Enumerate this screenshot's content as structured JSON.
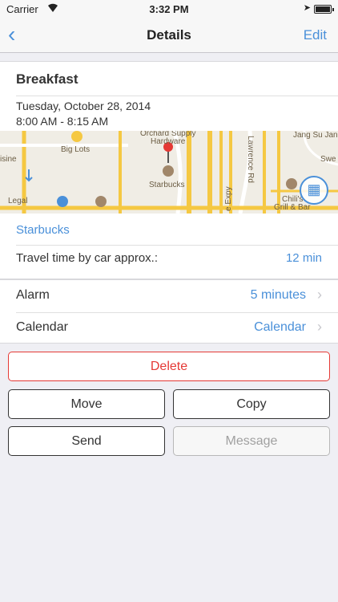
{
  "status": {
    "carrier": "Carrier",
    "time": "3:32 PM"
  },
  "nav": {
    "back": "‹",
    "title": "Details",
    "edit": "Edit"
  },
  "event": {
    "title": "Breakfast",
    "date": "Tuesday, October 28, 2014",
    "time": "8:00 AM - 8:15 AM",
    "place": "Starbucks",
    "travel_label": "Travel time by car approx.:",
    "travel_value": "12 min"
  },
  "map": {
    "labels": {
      "orchard": "Orchard Supply",
      "hardware": "Hardware",
      "jang": "Jang Su Jan",
      "big_lots": "Big Lots",
      "sisine": "isine",
      "swe": "Swe",
      "lawrence": "Lawrence Rd",
      "starbucks": "Starbucks",
      "expy": "e Expy",
      "chilis": "Chili's",
      "grill": "Grill & Bar",
      "legal": "Legal"
    }
  },
  "settings": [
    {
      "label": "Alarm",
      "value": "5 minutes"
    },
    {
      "label": "Calendar",
      "value": "Calendar"
    }
  ],
  "actions": {
    "delete": "Delete",
    "move": "Move",
    "copy": "Copy",
    "send": "Send",
    "message": "Message"
  },
  "colors": {
    "accent": "#4a90d9",
    "destructive": "#e53935",
    "pin": "#e53935"
  }
}
